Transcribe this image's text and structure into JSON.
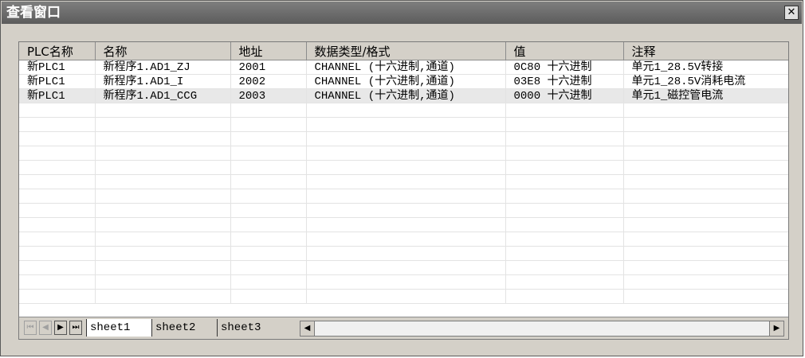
{
  "window": {
    "title": "查看窗口",
    "close_glyph": "✕"
  },
  "columns": [
    "PLC名称",
    "名称",
    "地址",
    "数据类型/格式",
    "值",
    "注释"
  ],
  "rows": [
    {
      "plc": "新PLC1",
      "name": "新程序1.AD1_ZJ",
      "addr": "2001",
      "type": "CHANNEL (十六进制,通道)",
      "value": "0C80 十六进制",
      "note": "单元1_28.5V转接"
    },
    {
      "plc": "新PLC1",
      "name": "新程序1.AD1_I",
      "addr": "2002",
      "type": "CHANNEL (十六进制,通道)",
      "value": "03E8 十六进制",
      "note": "单元1_28.5V消耗电流"
    },
    {
      "plc": "新PLC1",
      "name": "新程序1.AD1_CCG",
      "addr": "2003",
      "type": "CHANNEL (十六进制,通道)",
      "value": "0000 十六进制",
      "note": "单元1_磁控管电流"
    }
  ],
  "tabs": [
    "sheet1",
    "sheet2",
    "sheet3"
  ],
  "nav": {
    "first": "⏮",
    "prev": "◀",
    "next": "▶",
    "last": "⏭"
  },
  "scroll": {
    "left": "◀",
    "right": "▶"
  }
}
